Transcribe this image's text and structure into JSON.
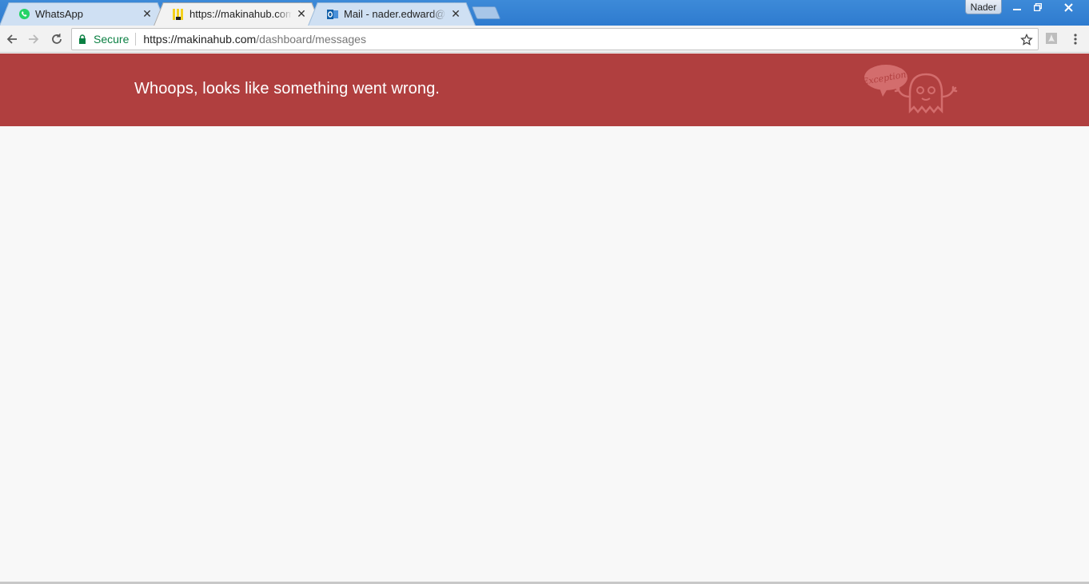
{
  "browser": {
    "tabs": [
      {
        "title": "WhatsApp",
        "icon": "whatsapp-icon",
        "active": false
      },
      {
        "title": "https://makinahub.com/dashboard/messages",
        "icon": "makinahub-icon",
        "active": true
      },
      {
        "title": "Mail - nader.edward@live.com",
        "icon": "outlook-icon",
        "active": false
      }
    ],
    "profile_name": "Nader",
    "window_controls": {
      "minimize": "—",
      "maximize": "❐",
      "close": "✕"
    }
  },
  "address_bar": {
    "security_label": "Secure",
    "url_host": "https://makinahub.com",
    "url_path": "/dashboard/messages"
  },
  "page": {
    "error_message": "Whoops, looks like something went wrong.",
    "mascot_bubble_text": "Exception!"
  },
  "colors": {
    "banner": "#b03f3f",
    "secure_green": "#0b8043",
    "titlebar_blue": "#2e7bcf"
  }
}
